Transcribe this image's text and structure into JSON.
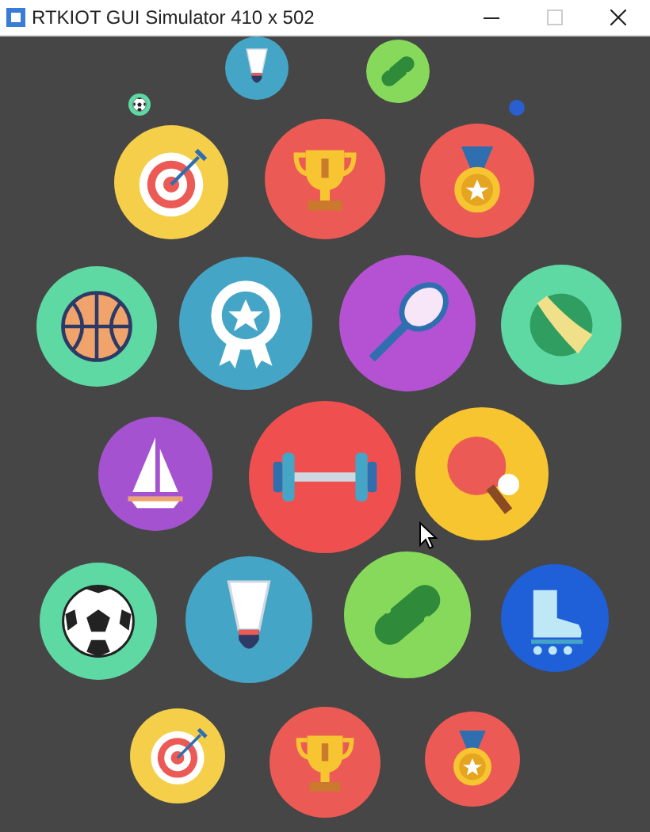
{
  "window": {
    "title": "RTKIOT GUI Simulator 410 x 502"
  },
  "apps": [
    {
      "kind": "shuttlecock"
    },
    {
      "kind": "skateboard"
    },
    {
      "kind": "soccer"
    },
    {
      "kind": "dot"
    },
    {
      "kind": "target"
    },
    {
      "kind": "trophy"
    },
    {
      "kind": "medal"
    },
    {
      "kind": "basketball"
    },
    {
      "kind": "award"
    },
    {
      "kind": "racket"
    },
    {
      "kind": "tennis"
    },
    {
      "kind": "sailboat"
    },
    {
      "kind": "dumbbell"
    },
    {
      "kind": "pingpong"
    },
    {
      "kind": "soccer"
    },
    {
      "kind": "shuttlecock"
    },
    {
      "kind": "skateboard"
    },
    {
      "kind": "skate"
    },
    {
      "kind": "target"
    },
    {
      "kind": "trophy"
    },
    {
      "kind": "medal"
    }
  ]
}
